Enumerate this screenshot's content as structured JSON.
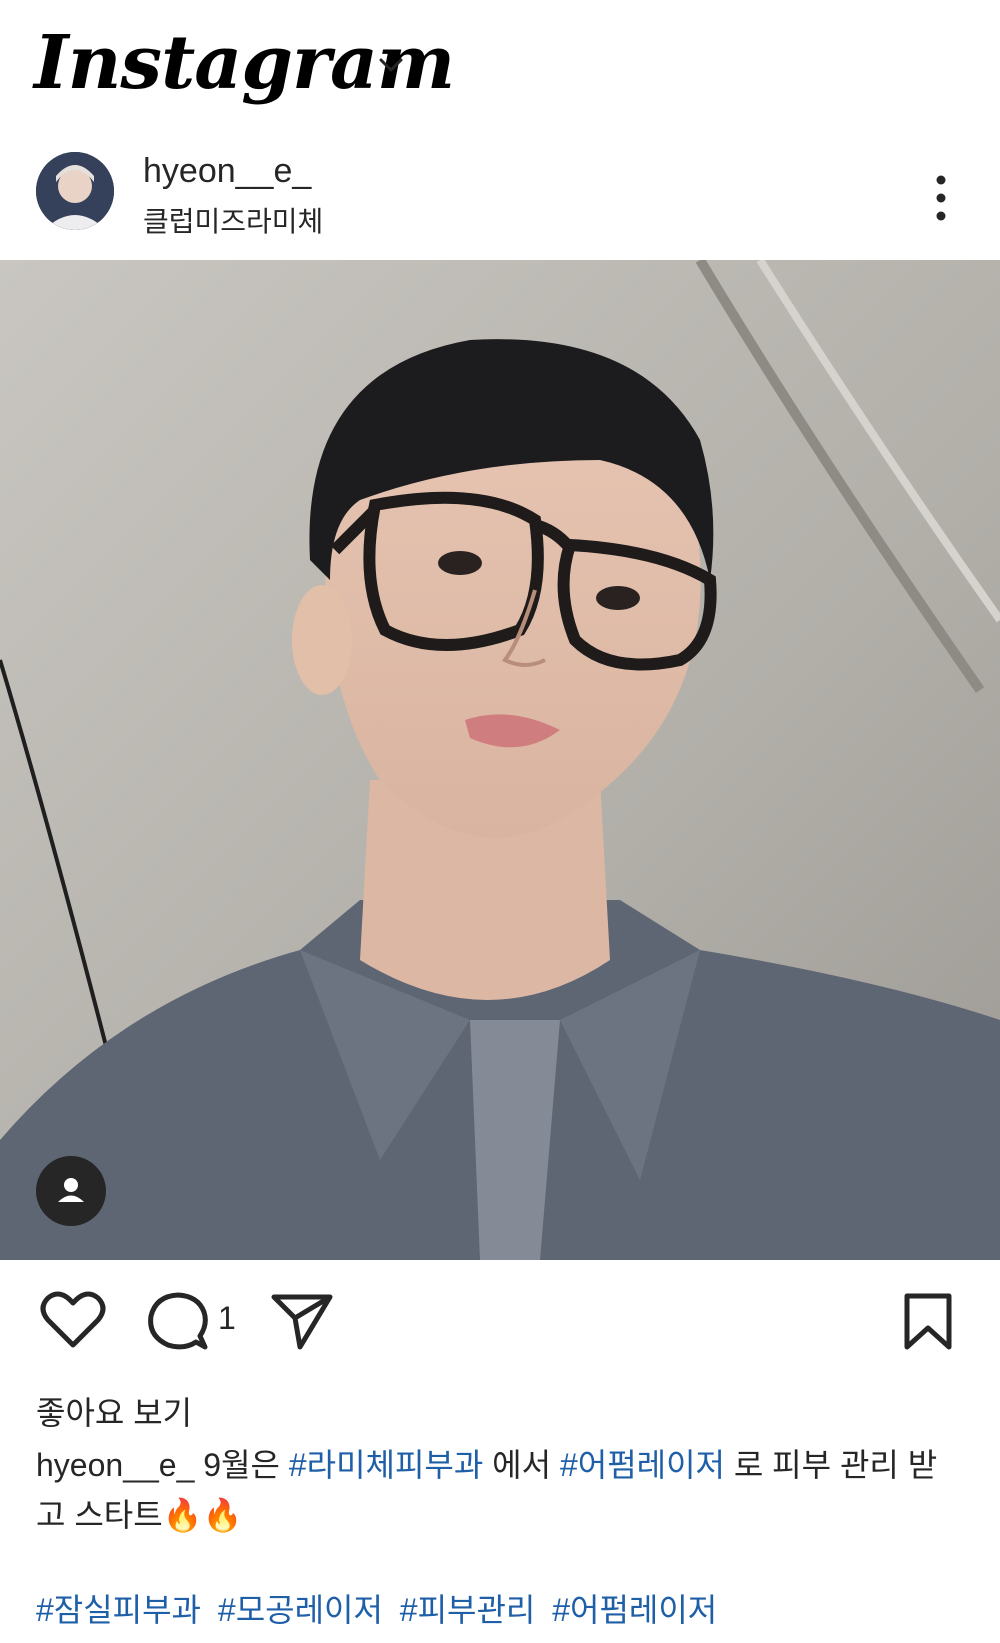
{
  "app": {
    "logo": "Instagram"
  },
  "post": {
    "username": "hyeon__e_",
    "location": "클럽미즈라미체",
    "comment_count": "1",
    "likes_label": "좋아요 보기",
    "caption": {
      "username": "hyeon__e_",
      "part1": "9월은",
      "tag1": "#라미체피부과",
      "part2": "에서",
      "tag2": "#어펌레이저",
      "part3": "로 피부 관리 받고 스타트🔥🔥"
    },
    "hashtags": [
      "#잠실피부과",
      "#모공레이저",
      "#피부관리",
      "#어펌레이저"
    ]
  },
  "icons": {
    "logo_dropdown": "chevron-down-icon",
    "more": "more-vertical-icon",
    "tag": "user-tag-icon",
    "like": "heart-icon",
    "comment": "comment-icon",
    "share": "send-icon",
    "save": "bookmark-icon"
  },
  "colors": {
    "hashtag": "#1f5fa8",
    "text": "#262626",
    "background": "#ffffff"
  }
}
